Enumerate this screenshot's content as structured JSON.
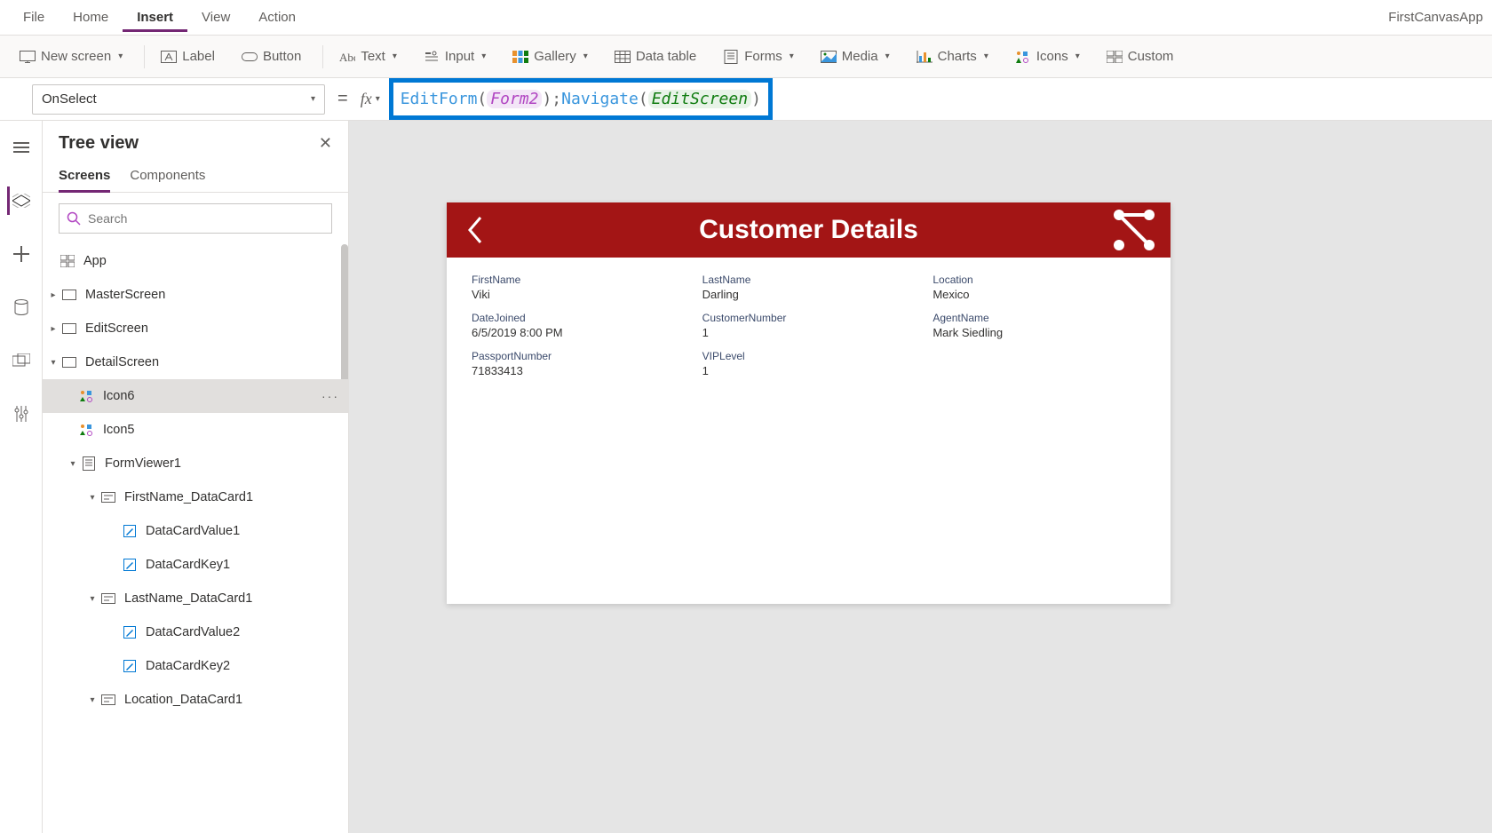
{
  "app_title": "FirstCanvasApp",
  "menubar": {
    "items": [
      "File",
      "Home",
      "Insert",
      "View",
      "Action"
    ],
    "active": "Insert"
  },
  "ribbon": {
    "new_screen": "New screen",
    "label": "Label",
    "button": "Button",
    "text": "Text",
    "input": "Input",
    "gallery": "Gallery",
    "data_table": "Data table",
    "forms": "Forms",
    "media": "Media",
    "charts": "Charts",
    "icons": "Icons",
    "custom": "Custom"
  },
  "formula": {
    "property": "OnSelect",
    "fn1": "EditForm",
    "arg1": "Form2",
    "fn2": "Navigate",
    "arg2": "EditScreen"
  },
  "tree": {
    "title": "Tree view",
    "tabs": {
      "screens": "Screens",
      "components": "Components"
    },
    "search_placeholder": "Search",
    "root": "App",
    "screens": {
      "master": "MasterScreen",
      "edit": "EditScreen",
      "detail": "DetailScreen"
    },
    "items": {
      "icon6": "Icon6",
      "icon5": "Icon5",
      "formviewer": "FormViewer1",
      "firstname_card": "FirstName_DataCard1",
      "dcv1": "DataCardValue1",
      "dck1": "DataCardKey1",
      "lastname_card": "LastName_DataCard1",
      "dcv2": "DataCardValue2",
      "dck2": "DataCardKey2",
      "location_card": "Location_DataCard1"
    },
    "more": "···"
  },
  "screen": {
    "title": "Customer Details",
    "fields": {
      "firstname": {
        "label": "FirstName",
        "value": "Viki"
      },
      "lastname": {
        "label": "LastName",
        "value": "Darling"
      },
      "location": {
        "label": "Location",
        "value": "Mexico"
      },
      "datejoined": {
        "label": "DateJoined",
        "value": "6/5/2019 8:00 PM"
      },
      "customernumber": {
        "label": "CustomerNumber",
        "value": "1"
      },
      "agentname": {
        "label": "AgentName",
        "value": "Mark Siedling"
      },
      "passportnumber": {
        "label": "PassportNumber",
        "value": "71833413"
      },
      "viplevel": {
        "label": "VIPLevel",
        "value": "1"
      }
    }
  }
}
